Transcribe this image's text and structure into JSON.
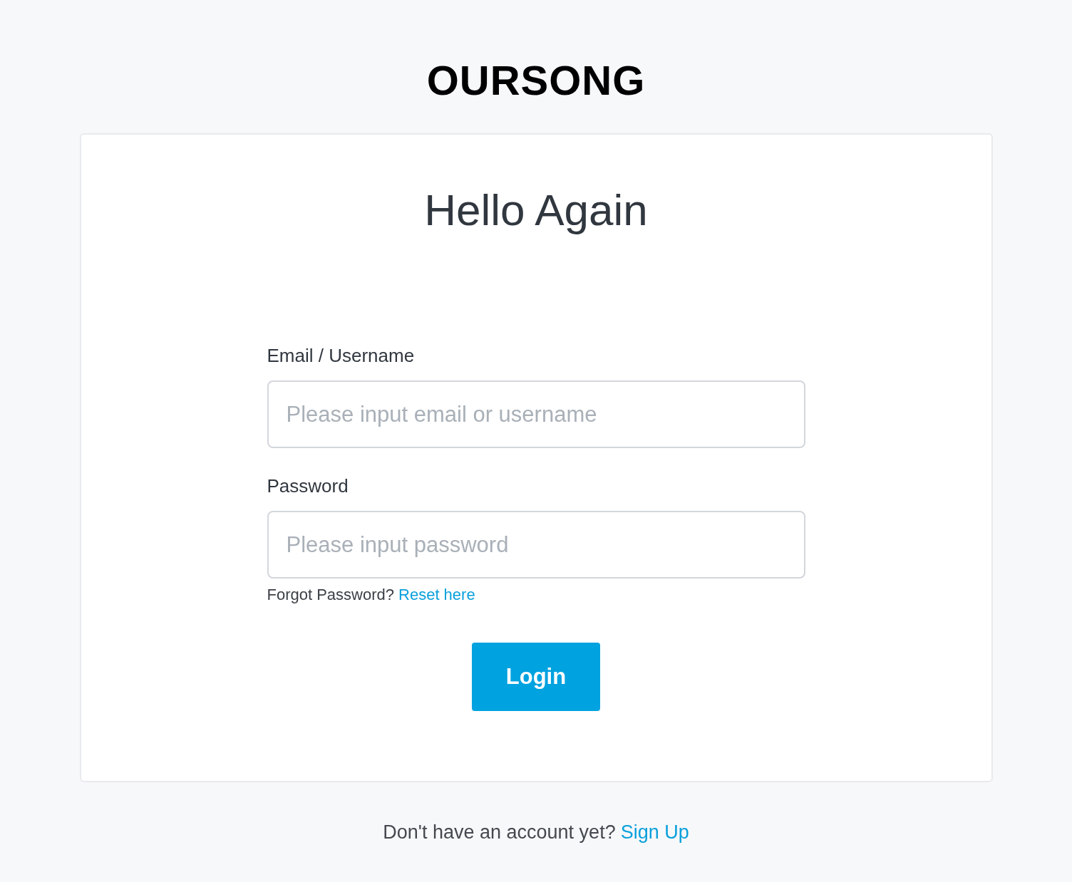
{
  "logo": "OURSONG",
  "heading": "Hello Again",
  "fields": [
    {
      "label": "Email / Username",
      "placeholder": "Please input email or username"
    },
    {
      "label": "Password",
      "placeholder": "Please input password"
    }
  ],
  "forgot": {
    "text": "Forgot Password?",
    "link": "Reset here"
  },
  "login_button": "Login",
  "footer": {
    "text": "Don't have an account yet?",
    "link": "Sign Up"
  }
}
